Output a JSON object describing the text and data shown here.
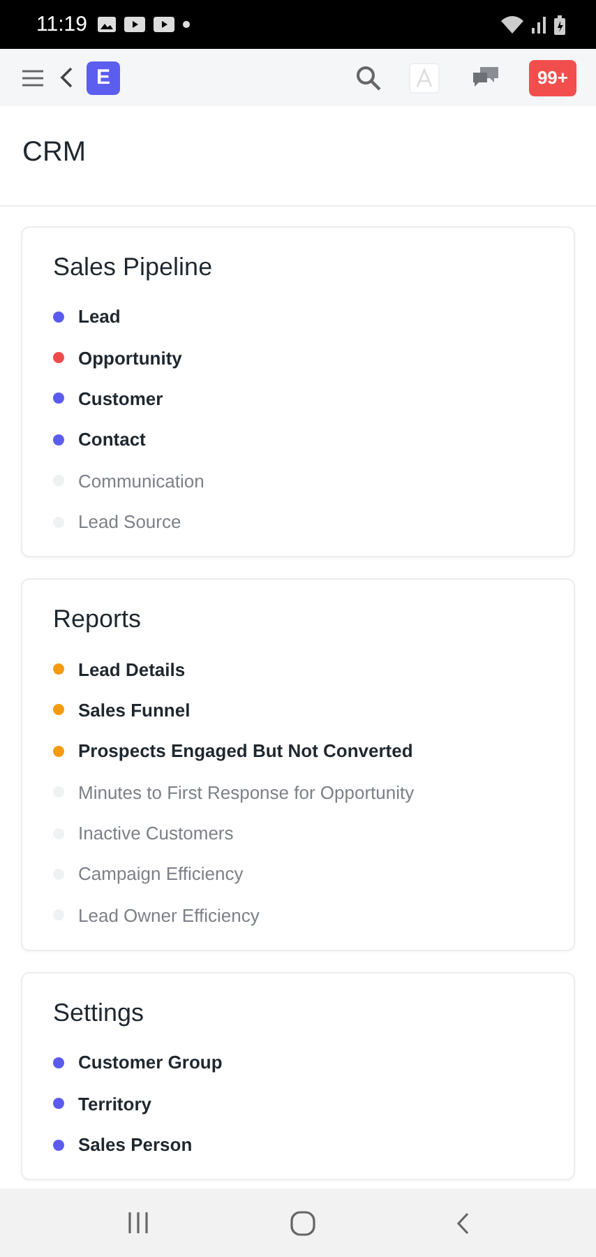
{
  "status_bar": {
    "time": "11:19"
  },
  "app_bar": {
    "logo": "E",
    "badge": "99+"
  },
  "page_title": "CRM",
  "cards": [
    {
      "title": "Sales Pipeline",
      "items": [
        {
          "label": "Lead",
          "color": "#5b5bf0",
          "muted": false
        },
        {
          "label": "Opportunity",
          "color": "#ef4a4a",
          "muted": false
        },
        {
          "label": "Customer",
          "color": "#5b5bf0",
          "muted": false
        },
        {
          "label": "Contact",
          "color": "#5b5bf0",
          "muted": false
        },
        {
          "label": "Communication",
          "color": "#f0f1f3",
          "muted": true
        },
        {
          "label": "Lead Source",
          "color": "#f0f1f3",
          "muted": true
        }
      ]
    },
    {
      "title": "Reports",
      "items": [
        {
          "label": "Lead Details",
          "color": "#f59a0e",
          "muted": false
        },
        {
          "label": "Sales Funnel",
          "color": "#f59a0e",
          "muted": false
        },
        {
          "label": "Prospects Engaged But Not Converted",
          "color": "#f59a0e",
          "muted": false
        },
        {
          "label": "Minutes to First Response for Opportunity",
          "color": "#f0f1f3",
          "muted": true
        },
        {
          "label": "Inactive Customers",
          "color": "#f0f1f3",
          "muted": true
        },
        {
          "label": "Campaign Efficiency",
          "color": "#f0f1f3",
          "muted": true
        },
        {
          "label": "Lead Owner Efficiency",
          "color": "#f0f1f3",
          "muted": true
        }
      ]
    },
    {
      "title": "Settings",
      "items": [
        {
          "label": "Customer Group",
          "color": "#5b5bf0",
          "muted": false
        },
        {
          "label": "Territory",
          "color": "#5b5bf0",
          "muted": false
        },
        {
          "label": "Sales Person",
          "color": "#5b5bf0",
          "muted": false
        }
      ]
    }
  ]
}
